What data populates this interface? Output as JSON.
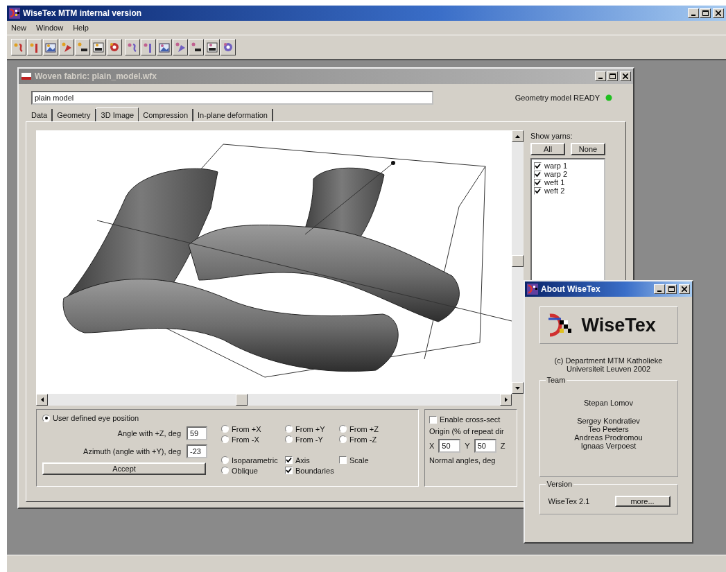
{
  "window": {
    "title": "WiseTex MTM internal version"
  },
  "menu": [
    {
      "label": "New"
    },
    {
      "label": "Window"
    },
    {
      "label": "Help"
    }
  ],
  "child_window": {
    "title": "Woven fabric: plain_model.wfx",
    "name_field": {
      "value": "plain model"
    },
    "status": {
      "text": "Geometry model READY"
    },
    "tabs": [
      {
        "label": "Data",
        "selected": false
      },
      {
        "label": "Geometry",
        "selected": false
      },
      {
        "label": "3D Image",
        "selected": true
      },
      {
        "label": "Compression",
        "selected": false
      },
      {
        "label": "In-plane deformation",
        "selected": false
      }
    ],
    "show_yarns": {
      "label": "Show yarns:",
      "buttons": [
        "All",
        "None"
      ],
      "yarns": [
        {
          "label": "warp 1",
          "checked": true
        },
        {
          "label": "warp 2",
          "checked": true
        },
        {
          "label": "weft 1",
          "checked": true
        },
        {
          "label": "weft 2",
          "checked": true
        }
      ]
    },
    "eye": {
      "label": "User defined eye position",
      "selected": true,
      "fields": [
        {
          "label": "Angle with +Z, deg",
          "value": "59"
        },
        {
          "label": "Azimuth (angle with +Y), deg",
          "value": "-23"
        }
      ],
      "accept": "Accept"
    },
    "view_options": [
      {
        "kind": "radio",
        "label": "From +X",
        "selected": false
      },
      {
        "kind": "radio",
        "label": "From +Y",
        "selected": false
      },
      {
        "kind": "radio",
        "label": "From +Z",
        "selected": false
      },
      {
        "kind": "radio",
        "label": "From -X",
        "selected": false
      },
      {
        "kind": "radio",
        "label": "From -Y",
        "selected": false
      },
      {
        "kind": "radio",
        "label": "From -Z",
        "selected": false
      },
      {
        "kind": "radio",
        "label": "Isoparametric",
        "selected": false
      },
      {
        "kind": "checkbox",
        "label": "Axis",
        "checked": true
      },
      {
        "kind": "checkbox",
        "label": "Scale",
        "checked": false
      },
      {
        "kind": "radio",
        "label": "Oblique",
        "selected": false
      },
      {
        "kind": "checkbox",
        "label": "Boundaries",
        "checked": true
      }
    ],
    "cross_section": {
      "enable": {
        "label": "Enable cross-sect",
        "checked": false
      },
      "origin_label": "Origin (% of repeat dir",
      "coords": [
        {
          "label": "X",
          "value": "50"
        },
        {
          "label": "Y",
          "value": "50"
        },
        {
          "label": "Z"
        }
      ],
      "normal_label": "Normal angles, deg"
    }
  },
  "about": {
    "title": "About WiseTex",
    "product": "WiseTex",
    "copyright_lines": [
      "(c) Department MTM  Katholieke",
      "Universiteit Leuven 2002"
    ],
    "team": {
      "label": "Team",
      "leader": "Stepan Lomov",
      "members": [
        "Sergey Kondratiev",
        "Teo Peeters",
        "Andreas Prodromou",
        "Ignaas Verpoest"
      ]
    },
    "version": {
      "label": "Version",
      "text": "WiseTex 2.1",
      "button": "more..."
    }
  }
}
